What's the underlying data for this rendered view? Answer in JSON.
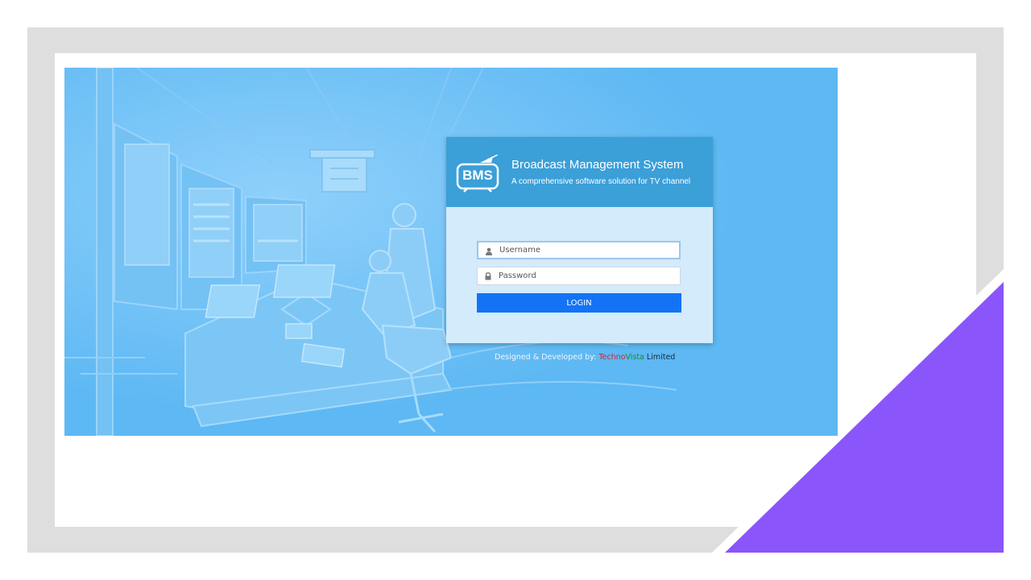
{
  "app": {
    "logo_text": "BMS",
    "title": "Broadcast Management System",
    "subtitle": "A comprehensive software solution for TV channel"
  },
  "login": {
    "username_placeholder": "Username",
    "password_placeholder": "Password",
    "button_label": "LOGIN"
  },
  "footer": {
    "prefix": "Designed & Developed by: ",
    "brand_part1": "Techno",
    "brand_part2": "Vista",
    "brand_part3": " Limited"
  },
  "colors": {
    "background_blue": "#5db8f3",
    "header_blue": "#3b9fd8",
    "button_blue": "#1473f5",
    "accent_purple": "#8b55fc"
  }
}
